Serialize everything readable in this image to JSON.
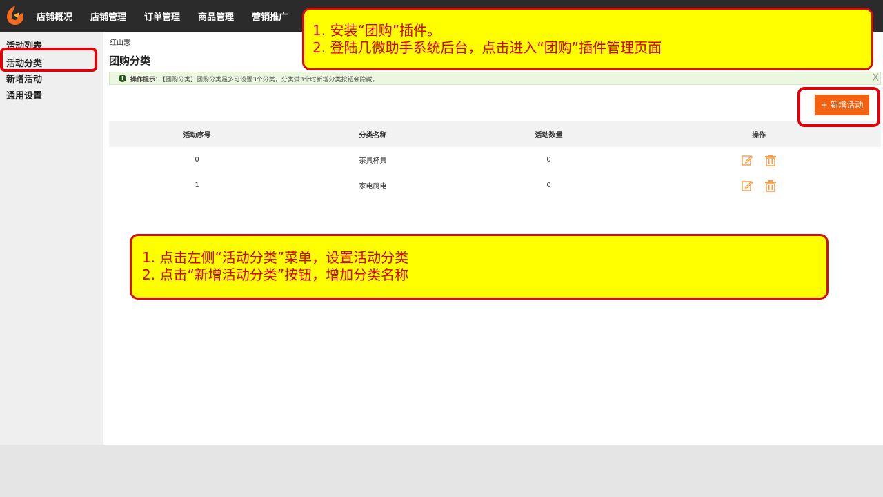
{
  "topnav": {
    "items": [
      "店铺概况",
      "店铺管理",
      "订单管理",
      "商品管理",
      "营销推广"
    ]
  },
  "sidebar": {
    "items": [
      {
        "label": "活动列表"
      },
      {
        "label": "活动分类"
      },
      {
        "label": "新增活动"
      },
      {
        "label": "通用设置"
      }
    ],
    "active_index": 1
  },
  "main": {
    "breadcrumb": "红山惠",
    "title": "团购分类",
    "tip": {
      "label": "操作提示：",
      "text": "【团购分类】团购分类最多可设置3个分类，分类满3个时新增分类按钮会隐藏。",
      "close": "X"
    },
    "add_button": "+ 新增活动",
    "table": {
      "headers": [
        "活动序号",
        "分类名称",
        "活动数量",
        "操作"
      ],
      "rows": [
        {
          "seq": "0",
          "name": "茶具杯具",
          "count": "0"
        },
        {
          "seq": "1",
          "name": "家电厨电",
          "count": "0"
        }
      ]
    }
  },
  "annotations": {
    "top": [
      "1. 安装“团购”插件。",
      "2. 登陆几微助手系统后台，点击进入“团购”插件管理页面"
    ],
    "bottom": [
      "1. 点击左侧“活动分类”菜单，设置活动分类",
      "2. 点击“新增活动分类”按钮，增加分类名称"
    ]
  },
  "colors": {
    "topbar": "#2b2b2b",
    "accent_orange": "#f5620f",
    "annotation_fill": "#ffff00",
    "annotation_border": "#d90c0c",
    "annotation_text": "#d60000"
  },
  "icons": {
    "logo": "brand-logo-icon",
    "tip": "info-icon",
    "edit": "edit-icon",
    "delete": "trash-icon"
  }
}
